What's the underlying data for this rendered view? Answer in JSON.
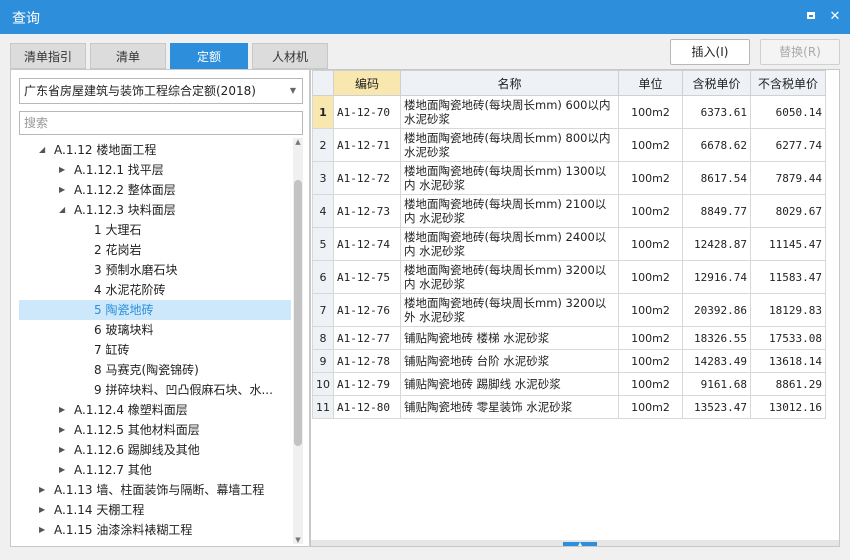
{
  "window": {
    "title": "查询"
  },
  "tabs": [
    "清单指引",
    "清单",
    "定额",
    "人材机"
  ],
  "buttons": {
    "insert": "插入(I)",
    "replace": "替换(R)"
  },
  "left": {
    "library_selected": "广东省房屋建筑与装饰工程综合定额(2018)",
    "search_placeholder": "搜索",
    "tree": [
      {
        "label": "A.1.12 楼地面工程",
        "expanded": true
      },
      {
        "label": "A.1.12.1 找平层",
        "expanded": false
      },
      {
        "label": "A.1.12.2 整体面层",
        "expanded": false
      },
      {
        "label": "A.1.12.3 块料面层",
        "expanded": true
      },
      {
        "label": "1 大理石"
      },
      {
        "label": "2 花岗岩"
      },
      {
        "label": "3 预制水磨石块"
      },
      {
        "label": "4 水泥花阶砖"
      },
      {
        "label": "5 陶瓷地砖",
        "selected": true
      },
      {
        "label": "6 玻璃块料"
      },
      {
        "label": "7 缸砖"
      },
      {
        "label": "8 马赛克(陶瓷锦砖)"
      },
      {
        "label": "9 拼碎块料、凹凸假麻石块、水..."
      },
      {
        "label": "A.1.12.4 橡塑料面层",
        "expanded": false
      },
      {
        "label": "A.1.12.5 其他材料面层",
        "expanded": false
      },
      {
        "label": "A.1.12.6 踢脚线及其他",
        "expanded": false
      },
      {
        "label": "A.1.12.7 其他",
        "expanded": false
      },
      {
        "label": "A.1.13 墙、柱面装饰与隔断、幕墙工程",
        "expanded": false
      },
      {
        "label": "A.1.14 天棚工程",
        "expanded": false
      },
      {
        "label": "A.1.15 油漆涂料裱糊工程",
        "expanded": false
      }
    ]
  },
  "table": {
    "columns": [
      "编码",
      "名称",
      "单位",
      "含税单价",
      "不含税单价"
    ],
    "rows": [
      {
        "n": "1",
        "code": "A1-12-70",
        "name": "楼地面陶瓷地砖(每块周长mm) 600以内 水泥砂浆",
        "unit": "100m2",
        "tax_price": "6373.61",
        "notax_price": "6050.14"
      },
      {
        "n": "2",
        "code": "A1-12-71",
        "name": "楼地面陶瓷地砖(每块周长mm) 800以内 水泥砂浆",
        "unit": "100m2",
        "tax_price": "6678.62",
        "notax_price": "6277.74"
      },
      {
        "n": "3",
        "code": "A1-12-72",
        "name": "楼地面陶瓷地砖(每块周长mm) 1300以内 水泥砂浆",
        "unit": "100m2",
        "tax_price": "8617.54",
        "notax_price": "7879.44"
      },
      {
        "n": "4",
        "code": "A1-12-73",
        "name": "楼地面陶瓷地砖(每块周长mm) 2100以内 水泥砂浆",
        "unit": "100m2",
        "tax_price": "8849.77",
        "notax_price": "8029.67"
      },
      {
        "n": "5",
        "code": "A1-12-74",
        "name": "楼地面陶瓷地砖(每块周长mm) 2400以内 水泥砂浆",
        "unit": "100m2",
        "tax_price": "12428.87",
        "notax_price": "11145.47"
      },
      {
        "n": "6",
        "code": "A1-12-75",
        "name": "楼地面陶瓷地砖(每块周长mm) 3200以内 水泥砂浆",
        "unit": "100m2",
        "tax_price": "12916.74",
        "notax_price": "11583.47"
      },
      {
        "n": "7",
        "code": "A1-12-76",
        "name": "楼地面陶瓷地砖(每块周长mm) 3200以外 水泥砂浆",
        "unit": "100m2",
        "tax_price": "20392.86",
        "notax_price": "18129.83"
      },
      {
        "n": "8",
        "code": "A1-12-77",
        "name": "铺贴陶瓷地砖 楼梯 水泥砂浆",
        "unit": "100m2",
        "tax_price": "18326.55",
        "notax_price": "17533.08"
      },
      {
        "n": "9",
        "code": "A1-12-78",
        "name": "铺贴陶瓷地砖 台阶 水泥砂浆",
        "unit": "100m2",
        "tax_price": "14283.49",
        "notax_price": "13618.14"
      },
      {
        "n": "10",
        "code": "A1-12-79",
        "name": "铺贴陶瓷地砖 踢脚线 水泥砂浆",
        "unit": "100m2",
        "tax_price": "9161.68",
        "notax_price": "8861.29"
      },
      {
        "n": "11",
        "code": "A1-12-80",
        "name": "铺贴陶瓷地砖 零星装饰 水泥砂浆",
        "unit": "100m2",
        "tax_price": "13523.47",
        "notax_price": "13012.16"
      }
    ]
  },
  "colors": {
    "accent": "#2d8fdb",
    "selected_bg": "#cde8fb",
    "header_sorted": "#f8e8b0"
  }
}
